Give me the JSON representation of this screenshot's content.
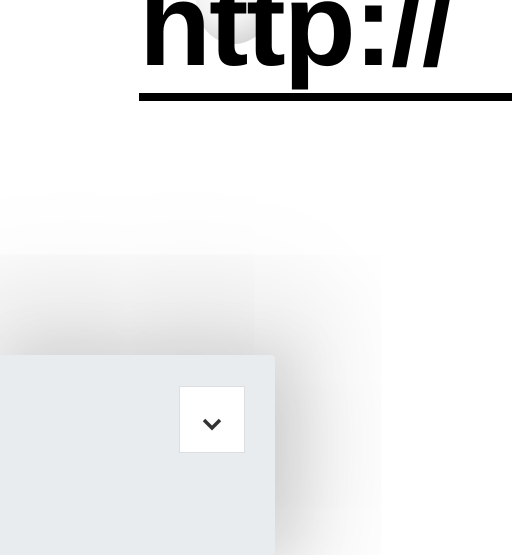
{
  "header": {
    "link_text": "http://"
  },
  "panel": {
    "toggle_icon": "chevron-down-icon"
  },
  "colors": {
    "panel_bg": "#e9ecee",
    "link": "#000000"
  }
}
